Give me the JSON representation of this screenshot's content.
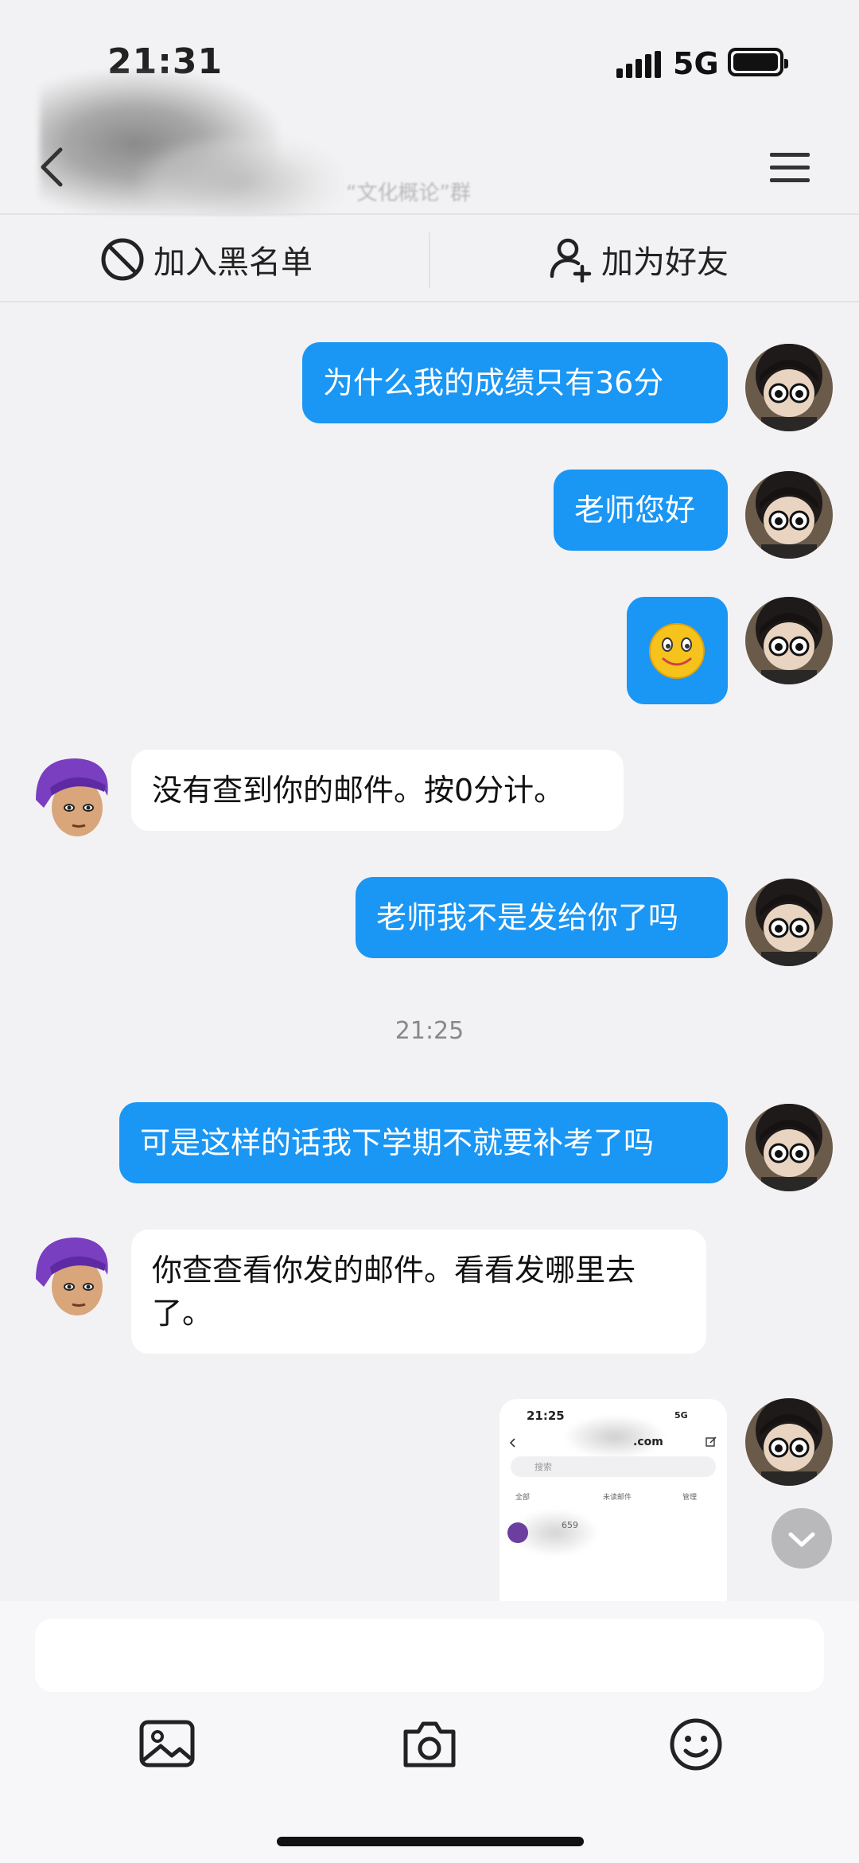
{
  "status": {
    "time": "21:31",
    "network": "5G"
  },
  "header": {
    "subtitle_blurred": "“文化概论”群"
  },
  "actions": {
    "block": "加入黑名单",
    "add_friend": "加为好友"
  },
  "messages": [
    {
      "from": "me",
      "text": "为什么我的成绩只有36分"
    },
    {
      "from": "me",
      "text": "老师您好"
    },
    {
      "from": "me",
      "type": "emoji",
      "icon": "smiley-emoji"
    },
    {
      "from": "them",
      "text": "没有查到你的邮件。按0分计。"
    },
    {
      "from": "me",
      "text": "老师我不是发给你了吗"
    },
    {
      "from": "me",
      "text": "可是这样的话我下学期不就要补考了吗"
    },
    {
      "from": "them",
      "text": "你查查看你发的邮件。看看发哪里去了。"
    },
    {
      "from": "me",
      "type": "image",
      "caption": "email-app-screenshot"
    }
  ],
  "timestamp": "21:25",
  "thumbnail": {
    "time": "21:25",
    "network": "5G",
    "email_domain": ".com",
    "search_placeholder": "搜索",
    "tab_all": "全部",
    "tab_unread": "未读邮件",
    "tab_manage": "管理",
    "row_fragment": "659"
  },
  "composer": {
    "placeholder": ""
  },
  "colors": {
    "bubble_me": "#1a96f5",
    "bubble_them": "#ffffff",
    "background": "#f2f2f4"
  }
}
